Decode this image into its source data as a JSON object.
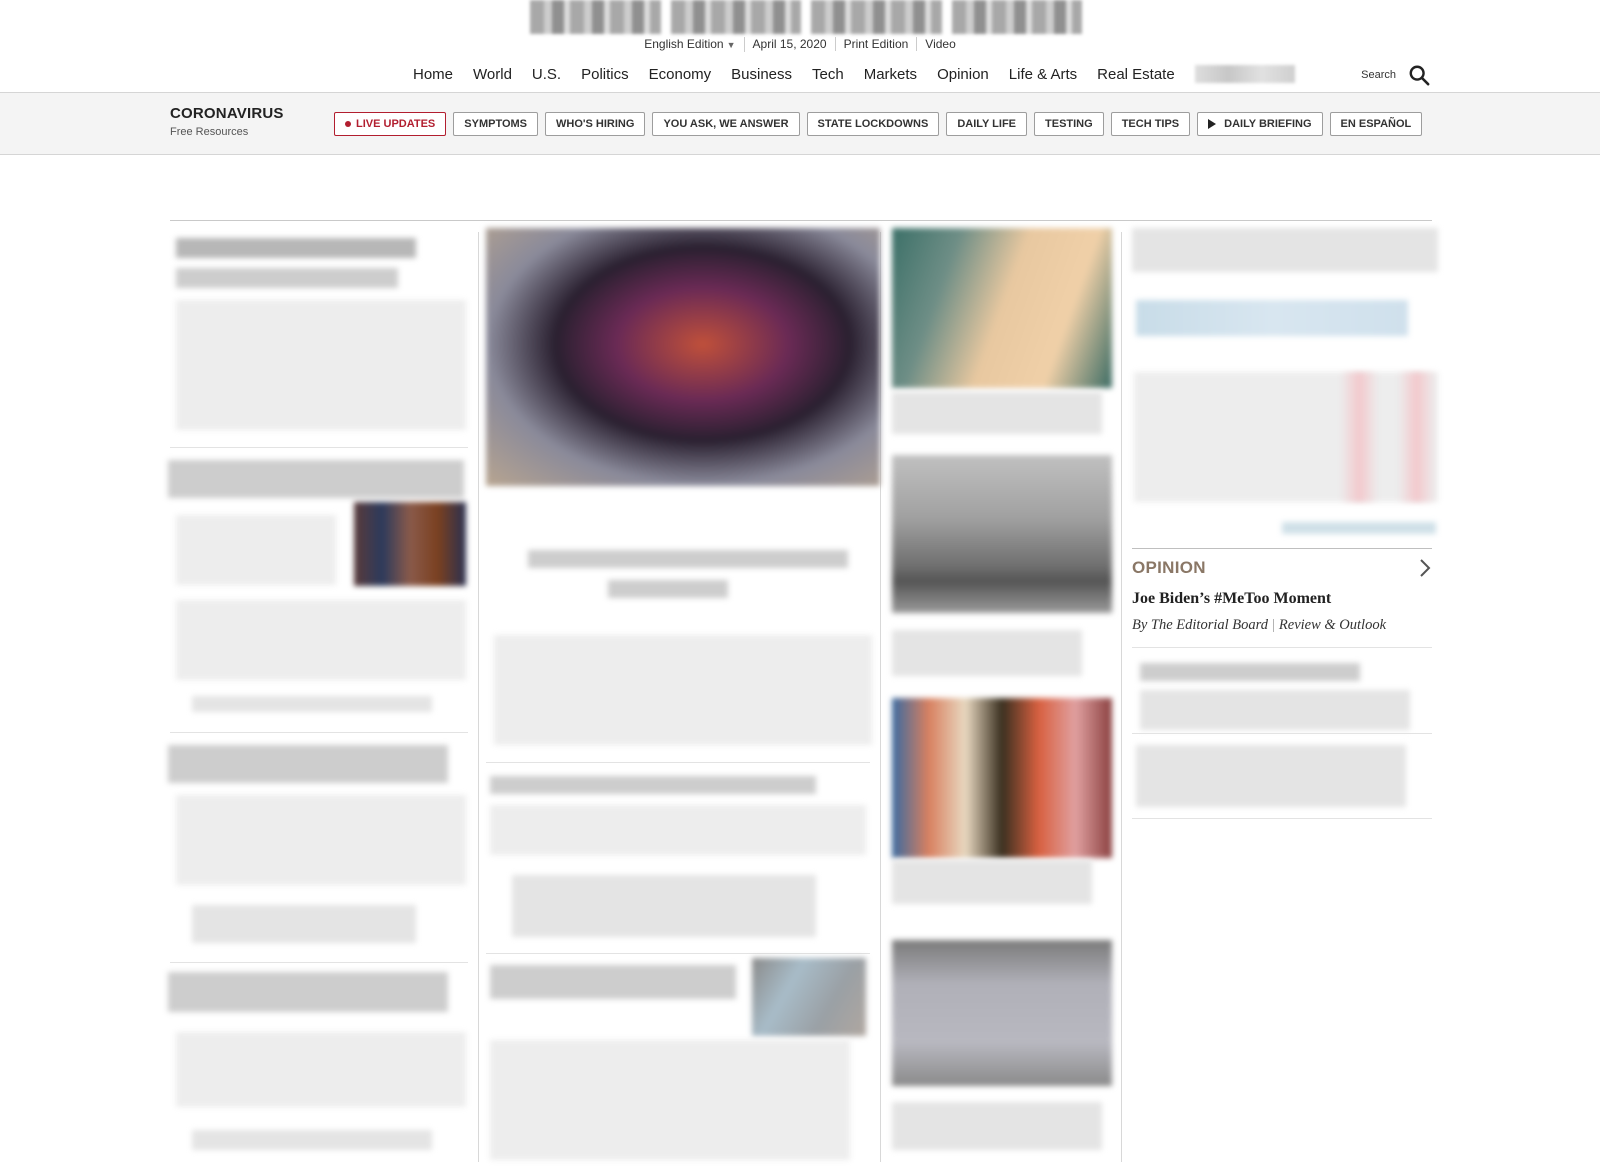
{
  "header": {
    "edition": "English Edition",
    "date": "April 15, 2020",
    "print_edition": "Print Edition",
    "video": "Video"
  },
  "nav": {
    "items": [
      "Home",
      "World",
      "U.S.",
      "Politics",
      "Economy",
      "Business",
      "Tech",
      "Markets",
      "Opinion",
      "Life & Arts",
      "Real Estate"
    ],
    "search_label": "Search"
  },
  "topic_bar": {
    "title": "CORONAVIRUS",
    "subtitle": "Free Resources",
    "buttons": [
      "LIVE UPDATES",
      "SYMPTOMS",
      "WHO'S HIRING",
      "YOU ASK, WE ANSWER",
      "STATE LOCKDOWNS",
      "DAILY LIFE",
      "TESTING",
      "TECH TIPS",
      "DAILY BRIEFING",
      "EN ESPAÑOL"
    ]
  },
  "opinion": {
    "label": "OPINION",
    "headline": "Joe Biden’s #MeToo Moment",
    "author": "By The Editorial Board",
    "section": "Review & Outlook"
  },
  "colors": {
    "live_red": "#b21e2f",
    "opinion_label": "#8a7766"
  }
}
